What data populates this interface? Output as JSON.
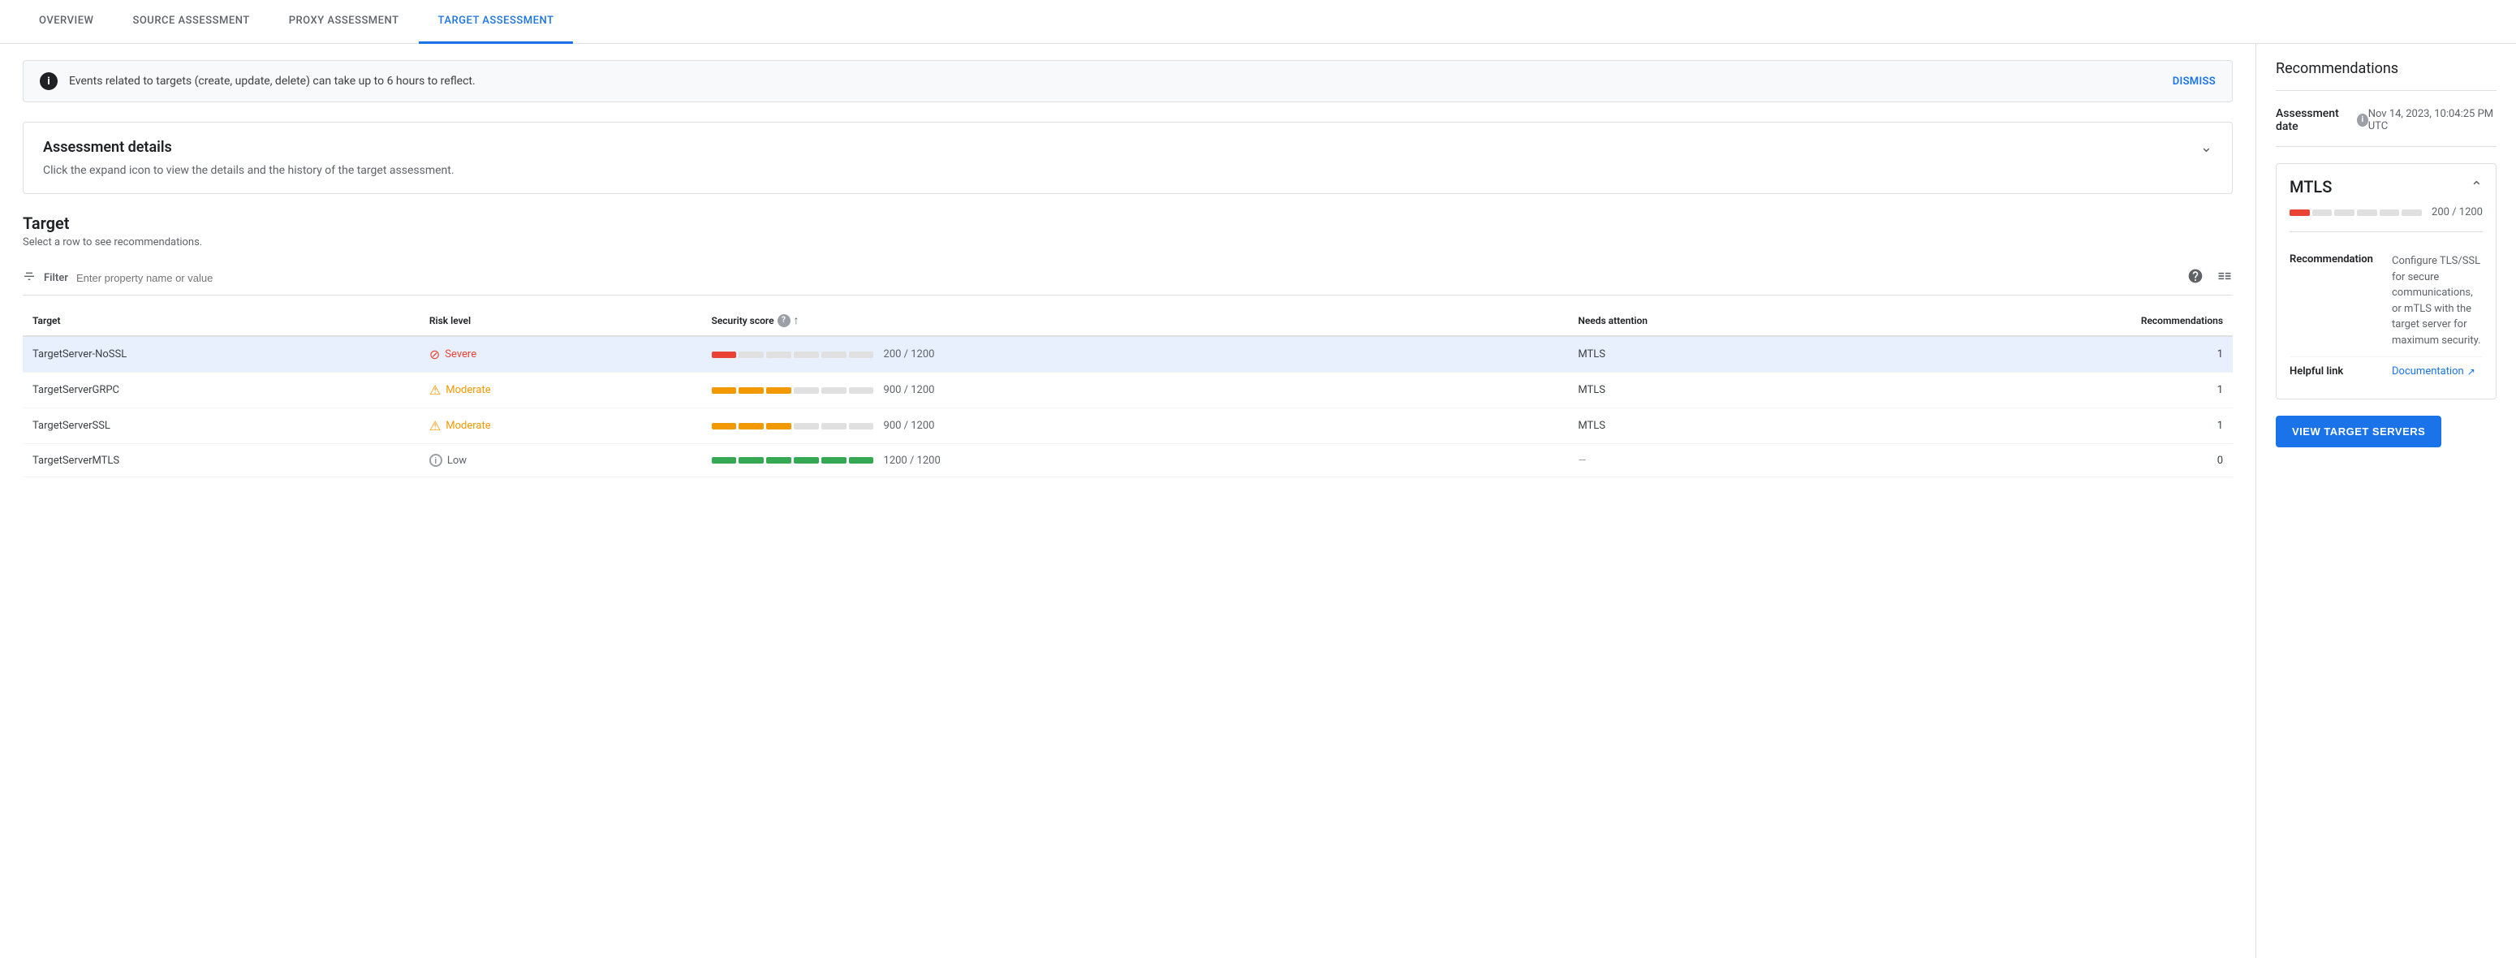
{
  "tabs": [
    {
      "id": "overview",
      "label": "OVERVIEW",
      "active": false
    },
    {
      "id": "source",
      "label": "SOURCE ASSESSMENT",
      "active": false
    },
    {
      "id": "proxy",
      "label": "PROXY ASSESSMENT",
      "active": false
    },
    {
      "id": "target",
      "label": "TARGET ASSESSMENT",
      "active": true
    }
  ],
  "banner": {
    "text": "Events related to targets (create, update, delete) can take up to 6 hours to reflect.",
    "dismiss_label": "DISMISS"
  },
  "assessment_details": {
    "title": "Assessment details",
    "description": "Click the expand icon to view the details and the history of the target assessment."
  },
  "target_section": {
    "title": "Target",
    "subtitle": "Select a row to see recommendations.",
    "filter_placeholder": "Enter property name or value",
    "filter_label": "Filter",
    "columns": {
      "target": "Target",
      "risk_level": "Risk level",
      "security_score": "Security score",
      "needs_attention": "Needs attention",
      "recommendations": "Recommendations"
    },
    "rows": [
      {
        "id": "row-1",
        "target": "TargetServer-NoSSL",
        "risk": "Severe",
        "risk_level": "severe",
        "score_filled": 1,
        "score_total": 6,
        "score_label": "200 / 1200",
        "score_color": "red",
        "needs_attention": "MTLS",
        "recommendations": "1",
        "selected": true
      },
      {
        "id": "row-2",
        "target": "TargetServerGRPC",
        "risk": "Moderate",
        "risk_level": "moderate",
        "score_filled": 3,
        "score_total": 6,
        "score_label": "900 / 1200",
        "score_color": "orange",
        "needs_attention": "MTLS",
        "recommendations": "1",
        "selected": false
      },
      {
        "id": "row-3",
        "target": "TargetServerSSL",
        "risk": "Moderate",
        "risk_level": "moderate",
        "score_filled": 3,
        "score_total": 6,
        "score_label": "900 / 1200",
        "score_color": "orange",
        "needs_attention": "MTLS",
        "recommendations": "1",
        "selected": false
      },
      {
        "id": "row-4",
        "target": "TargetServerMTLS",
        "risk": "Low",
        "risk_level": "low",
        "score_filled": 6,
        "score_total": 6,
        "score_label": "1200 / 1200",
        "score_color": "green",
        "needs_attention": "—",
        "recommendations": "0",
        "selected": false
      }
    ]
  },
  "sidebar": {
    "title": "Recommendations",
    "assessment_date_label": "Assessment date",
    "assessment_date_value": "Nov 14, 2023, 10:04:25 PM UTC",
    "mtls": {
      "title": "MTLS",
      "score_label": "200 / 1200",
      "score_filled": 1,
      "score_total": 6,
      "recommendation_label": "Recommendation",
      "recommendation_text": "Configure TLS/SSL for secure communications, or mTLS with the target server for maximum security.",
      "helpful_link_label": "Helpful link",
      "helpful_link_text": "Documentation",
      "helpful_link_icon": "↗"
    },
    "view_btn_label": "VIEW TARGET SERVERS"
  }
}
